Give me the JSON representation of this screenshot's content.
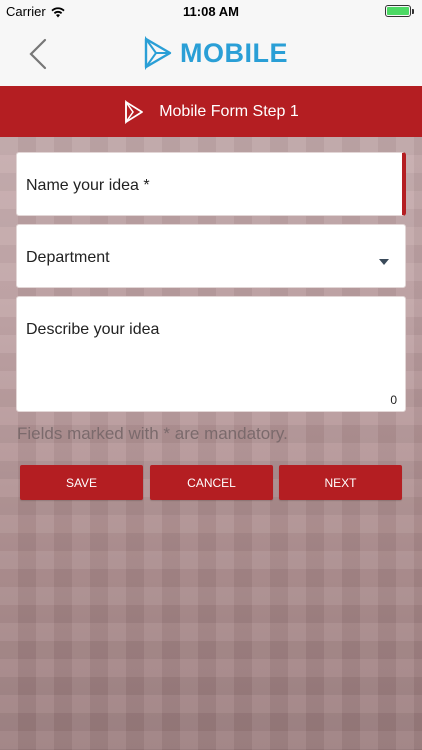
{
  "status_bar": {
    "carrier": "Carrier",
    "time": "11:08 AM",
    "battery_level": 1.0
  },
  "nav": {
    "brand_name": "MOBILE",
    "brand_color": "#2a9fd6",
    "back_icon": "chevron-left-icon"
  },
  "header": {
    "title": "Mobile Form Step 1",
    "color": "#b41e22"
  },
  "form": {
    "name_field": {
      "placeholder": "Name your idea *"
    },
    "department_field": {
      "placeholder": "Department"
    },
    "description_field": {
      "placeholder": "Describe your idea",
      "char_count": "0"
    },
    "mandatory_note": "Fields marked with * are mandatory."
  },
  "buttons": {
    "save": "SAVE",
    "cancel": "CANCEL",
    "next": "NEXT"
  }
}
